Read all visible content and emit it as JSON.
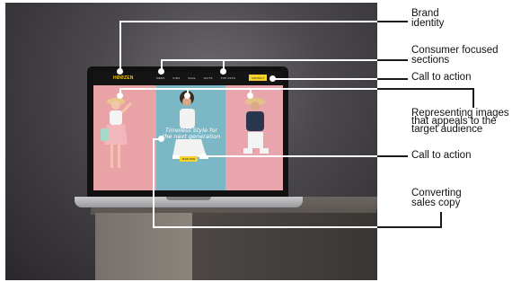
{
  "website": {
    "logo": "HØØZEN",
    "nav": [
      "MENS",
      "KIDS",
      "SALE",
      "GIFTS",
      "TOP OFFS"
    ],
    "nav_cta": "CONTACT",
    "hero_title": "Timeless Style for the next generation",
    "hero_cta": "SHOP NOW"
  },
  "callouts": {
    "brand_identity": "Brand identity",
    "consumer_sections": "Consumer focused sections",
    "cta_top": "Call to action",
    "representing_images": "Representing images that appeals to the target audience",
    "cta_middle": "Call to action",
    "sales_copy": "Converting sales copy"
  },
  "colors": {
    "accent_yellow": "#f5d32a",
    "panel_pink": "#e9a2a6",
    "panel_blue": "#7bb7c4"
  }
}
